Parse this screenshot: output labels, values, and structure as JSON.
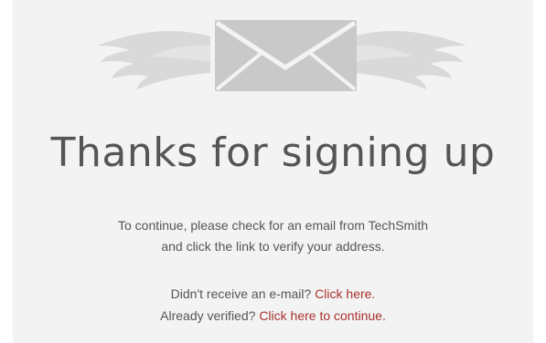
{
  "header": {
    "icon": "winged-envelope-icon"
  },
  "main": {
    "title": "Thanks for signing up",
    "description_line1": "To continue, please check for an email from TechSmith",
    "description_line2": "and click the link to verify your address.",
    "resend_prompt": "Didn't receive an e-mail? ",
    "resend_link": "Click here.",
    "verified_prompt": "Already verified? ",
    "continue_link": "Click here to continue."
  },
  "colors": {
    "background": "#f3f3f3",
    "text": "#555555",
    "link": "#a8322d",
    "icon": "#c9c9c9"
  }
}
